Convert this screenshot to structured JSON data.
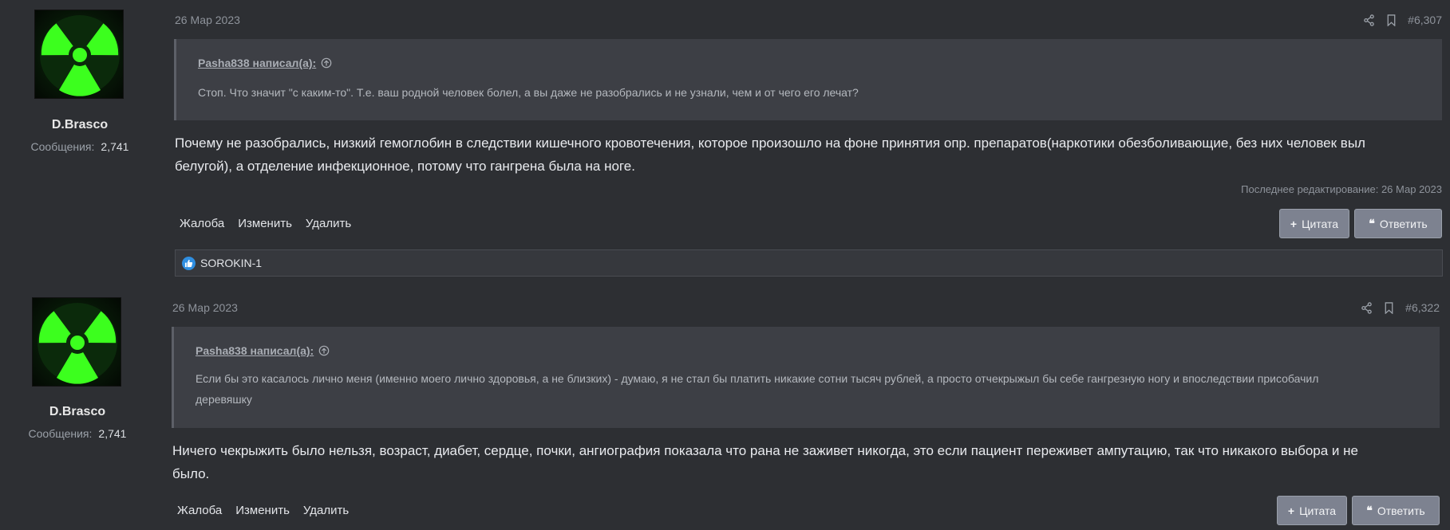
{
  "posts": [
    {
      "user": {
        "name": "D.Brasco",
        "messages_label": "Сообщения:",
        "messages_count": "2,741"
      },
      "date": "26 Мар 2023",
      "post_number": "#6,307",
      "quote": {
        "author": "Pasha838 написал(а):",
        "text": "Стоп. Что значит \"с каким-то\". Т.е. ваш родной человек болел, а вы даже не разобрались и не узнали, чем и от чего его лечат?"
      },
      "body_lines": [
        "Почему не разобрались, низкий гемоглобин в следствии кишечного кровотечения, которое произошло на фоне принятия опр. препаратов(наркотики обезболивающие, без них человек выл",
        "белугой), а отделение инфекционное, потому что гангрена была на ноге."
      ],
      "edited": "Последнее редактирование: 26 Мар 2023",
      "actions": {
        "report": "Жалоба",
        "edit": "Изменить",
        "delete": "Удалить"
      },
      "buttons": {
        "quote": "Цитата",
        "reply": "Ответить"
      },
      "reaction_user": "SOROKIN-1"
    },
    {
      "user": {
        "name": "D.Brasco",
        "messages_label": "Сообщения:",
        "messages_count": "2,741"
      },
      "date": "26 Мар 2023",
      "post_number": "#6,322",
      "quote": {
        "author": "Pasha838 написал(а):",
        "text_lines": [
          "Если бы это касалось лично меня (именно моего лично здоровья, а не близких) - думаю, я не стал бы платить никакие сотни тысяч рублей, а просто отчекрыжыл бы себе гангрезную ногу и впоследствии присобачил",
          "деревяшку"
        ]
      },
      "body_lines": [
        "Ничего чекрыжить было нельзя, возраст, диабет, сердце, почки, ангиография показала что рана не заживет никогда, это если пациент переживет ампутацию, так что никакого выбора и не",
        "было."
      ],
      "actions": {
        "report": "Жалоба",
        "edit": "Изменить",
        "delete": "Удалить"
      },
      "buttons": {
        "quote": "Цитата",
        "reply": "Ответить"
      }
    }
  ],
  "colors": {
    "background": "#2d2f33",
    "quote_bg": "#3d3f45",
    "button_bg": "#7d8290",
    "like_blue": "#2f8ee0",
    "avatar_green": "#39ff14"
  },
  "icons": [
    "share-icon",
    "bookmark-icon",
    "arrow-up-circle-icon",
    "plus-icon",
    "quote-marks-icon",
    "thumbs-up-icon",
    "radiation-avatar"
  ]
}
